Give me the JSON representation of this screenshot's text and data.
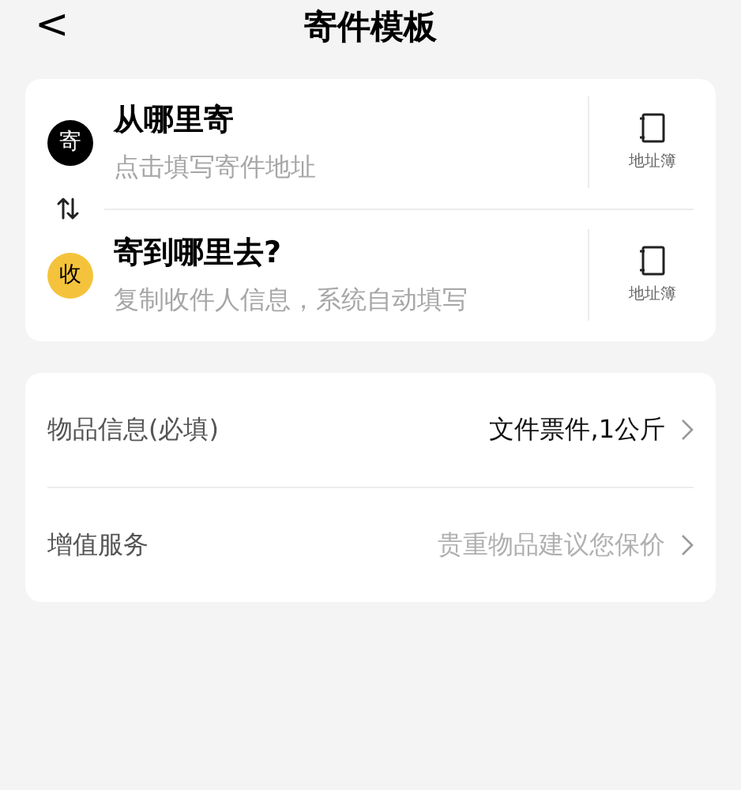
{
  "header": {
    "back": "<",
    "title": "寄件模板"
  },
  "addresses": [
    {
      "badge": "寄",
      "color": "#000000",
      "title": "从哪里寄",
      "hint": "点击填写寄件地址",
      "book": "地址簿"
    },
    {
      "badge": "收",
      "color": "#f5c33b",
      "title": "寄到哪里去?",
      "hint": "复制收件人信息，系统自动填写",
      "book": "地址簿"
    }
  ],
  "options": [
    {
      "label": "物品信息(必填)",
      "value": "文件票件,1公斤",
      "kind": "value"
    },
    {
      "label": "增值服务",
      "value": "贵重物品建议您保价",
      "kind": "hint"
    }
  ]
}
